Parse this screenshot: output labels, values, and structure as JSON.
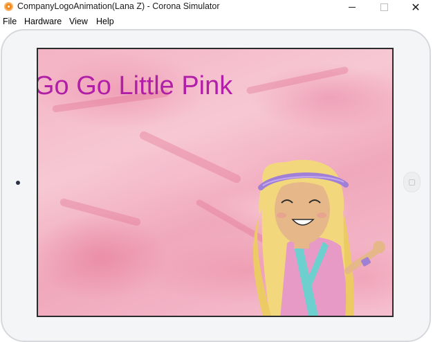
{
  "window": {
    "title": "CompanyLogoAnimation(Lana Z) - Corona Simulator",
    "app_icon": "corona-sdk-icon",
    "controls": {
      "minimize": "minimize-icon",
      "maximize": "maximize-icon",
      "close_glyph": "✕"
    }
  },
  "menu": {
    "items": [
      {
        "label": "File"
      },
      {
        "label": "Hardware"
      },
      {
        "label": "View"
      },
      {
        "label": "Help"
      }
    ]
  },
  "device": {
    "skin": "iPad",
    "frame_color": "#f4f5f7",
    "sensor_icon": "camera-dot-icon",
    "home_icon": "home-button-icon"
  },
  "screen": {
    "title": "Go Go Little Pink",
    "title_color": "#b21fa7",
    "background": "pink-watercolor",
    "character": "girl-with-blonde-hair-and-purple-headband"
  }
}
